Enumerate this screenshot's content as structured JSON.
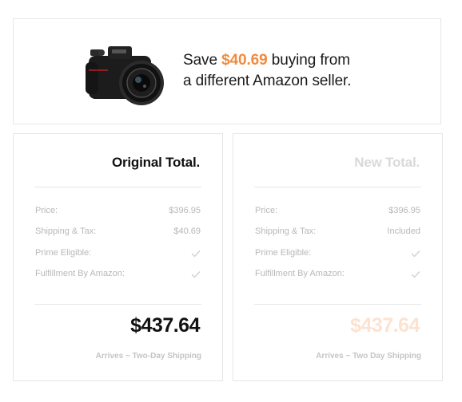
{
  "hero": {
    "prefix": "Save ",
    "savings": "$40.69",
    "suffix": " buying from",
    "line2": "a different Amazon seller."
  },
  "original": {
    "title": "Original Total.",
    "rows": [
      {
        "label": "Price:",
        "value": "$396.95"
      },
      {
        "label": "Shipping & Tax:",
        "value": "$40.69"
      },
      {
        "label": "Prime Eligible:",
        "value": ""
      },
      {
        "label": "Fulfillment By Amazon:",
        "value": ""
      }
    ],
    "total": "$437.64",
    "arrives": "Arrives ~ Two-Day Shipping"
  },
  "new": {
    "title": "New Total.",
    "rows": [
      {
        "label": "Price:",
        "value": "$396.95"
      },
      {
        "label": "Shipping & Tax:",
        "value": "Included"
      },
      {
        "label": "Prime Eligible:",
        "value": ""
      },
      {
        "label": "Fulfillment By Amazon:",
        "value": ""
      }
    ],
    "total": "$437.64",
    "arrives": "Arrives ~ Two Day Shipping"
  },
  "colors": {
    "accent": "#f28a3a",
    "new_total": "#fde2d0"
  },
  "icons": {
    "product": "camera-icon",
    "check": "check-icon"
  }
}
